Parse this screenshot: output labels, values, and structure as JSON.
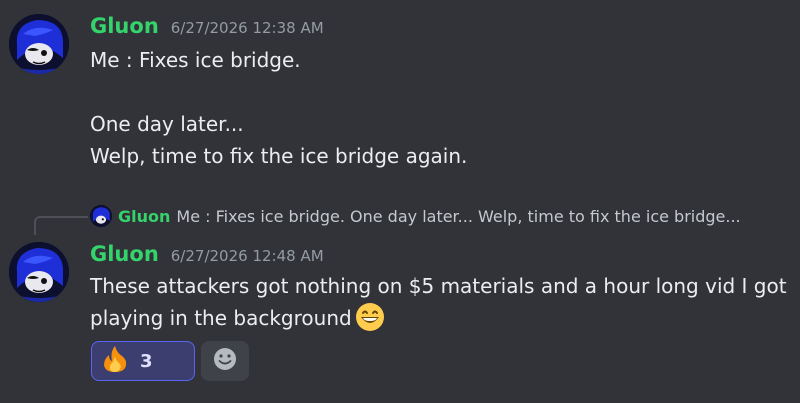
{
  "colors": {
    "background": "#323339",
    "username": "#35d36b",
    "timestamp": "#949ba4",
    "text": "#ecedf0",
    "reaction_active_bg": "#3b3e6e",
    "reaction_active_border": "#5865f2"
  },
  "messages": [
    {
      "author": "Gluon",
      "timestamp": "6/27/2026 12:38 AM",
      "lines": [
        "Me : Fixes ice bridge.",
        "",
        "One day later...",
        "Welp, time to fix the ice bridge again."
      ]
    },
    {
      "reply": {
        "author": "Gluon",
        "preview": "Me : Fixes ice bridge.  One day later... Welp, time to fix the ice bridge..."
      },
      "author": "Gluon",
      "timestamp": "6/27/2026 12:48 AM",
      "lines": [
        "These attackers got nothing on $5 materials and a hour long vid I got",
        "playing in the background"
      ],
      "inline_emoji": "grinning-smile-emoji",
      "reactions": [
        {
          "emoji": "fire-emoji",
          "count": "3",
          "active": true
        }
      ],
      "add_reaction_icon": "smiley-face-icon"
    }
  ]
}
